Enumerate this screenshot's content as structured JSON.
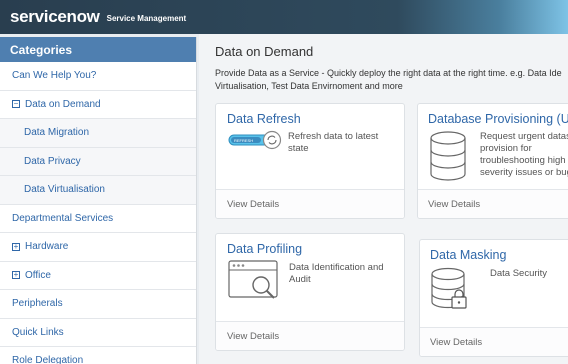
{
  "header": {
    "logo": "servicenow",
    "subtitle": "Service Management"
  },
  "sidebar": {
    "title": "Categories",
    "items": [
      {
        "label": "Can We Help You?"
      },
      {
        "label": "Data on Demand",
        "toggle": "−"
      },
      {
        "label": "Data Migration"
      },
      {
        "label": "Data Privacy"
      },
      {
        "label": "Data Virtualisation"
      },
      {
        "label": "Departmental Services"
      },
      {
        "label": "Hardware",
        "toggle": "+"
      },
      {
        "label": "Office",
        "toggle": "+"
      },
      {
        "label": "Peripherals"
      },
      {
        "label": "Quick Links"
      },
      {
        "label": "Role Delegation"
      }
    ]
  },
  "main": {
    "title": "Data on Demand",
    "description_line1": "Provide Data as a Service - Quickly deploy the right data at the right time. e.g. Data Ide",
    "description_line2": "Virtualisation, Test Data Envirnoment and more",
    "cards": [
      {
        "title": "Data Refresh",
        "text": [
          "Refresh data to latest",
          "state"
        ],
        "link": "View Details",
        "badge": "REFRESH"
      },
      {
        "title": "Database Provisioning (Urg",
        "text": [
          "Request urgent datase",
          "provision for",
          "troubleshooting high",
          "severity issues or bug"
        ],
        "link": "View Details"
      },
      {
        "title": "Data Profiling",
        "text": [
          "Data Identification and",
          "Audit"
        ],
        "link": "View Details"
      },
      {
        "title": "Data Masking",
        "text": [
          "Data Security"
        ],
        "link": "View Details"
      }
    ]
  }
}
